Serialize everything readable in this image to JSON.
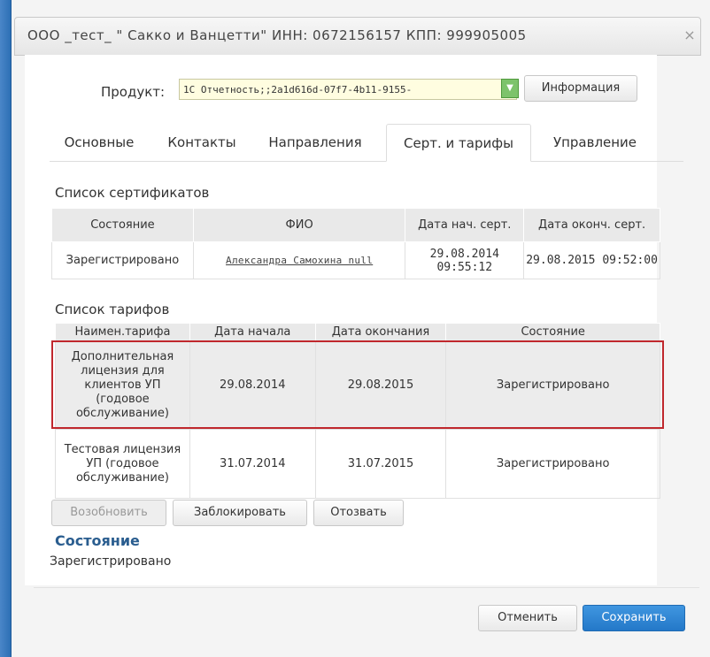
{
  "window": {
    "title": "ООО _тест_ \" Сакко и Ванцетти\" ИНН: 0672156157 КПП: 999905005",
    "close_glyph": "×"
  },
  "product": {
    "label": "Продукт:",
    "selected": "1С Отчетность;;2a1d616d-07f7-4b11-9155-",
    "info_button": "Информация"
  },
  "tabs": [
    {
      "label": "Основные"
    },
    {
      "label": "Контакты"
    },
    {
      "label": "Направления"
    },
    {
      "label": "Серт. и тарифы",
      "active": true
    },
    {
      "label": "Управление"
    }
  ],
  "certificates": {
    "title": "Список сертификатов",
    "headers": [
      "Состояние",
      "ФИО",
      "Дата нач. серт.",
      "Дата оконч. серт."
    ],
    "rows": [
      {
        "state": "Зарегистрировано",
        "name": "Александра Самохина null",
        "start": "29.08.2014 09:55:12",
        "end": "29.08.2015 09:52:00"
      }
    ]
  },
  "tariffs": {
    "title": "Список тарифов",
    "headers": [
      "Наимен.тарифа",
      "Дата начала",
      "Дата окончания",
      "Состояние"
    ],
    "rows": [
      {
        "name": "Дополнительная лицензия для клиентов УП (годовое обслуживание)",
        "start": "29.08.2014",
        "end": "29.08.2015",
        "state": "Зарегистрировано",
        "selected": true
      },
      {
        "name": "Тестовая лицензия УП (годовое обслуживание)",
        "start": "31.07.2014",
        "end": "31.07.2015",
        "state": "Зарегистрировано"
      }
    ],
    "buttons": {
      "renew": "Возобновить",
      "block": "Заблокировать",
      "revoke": "Отозвать"
    }
  },
  "state_section": {
    "heading": "Состояние",
    "value": "Зарегистрировано"
  },
  "footer": {
    "cancel": "Отменить",
    "save": "Сохранить"
  },
  "colors": {
    "accent": "#2478c8",
    "selection": "#c0282d",
    "heading": "#2a5d8f"
  }
}
